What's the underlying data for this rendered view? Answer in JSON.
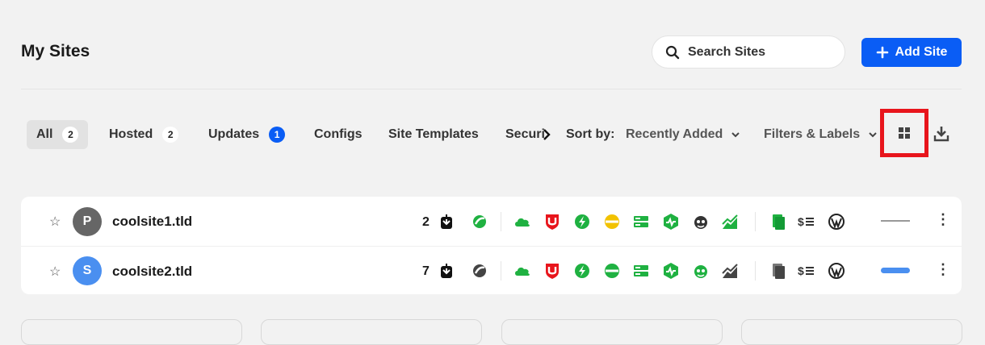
{
  "header": {
    "title": "My Sites",
    "search_placeholder": "Search Sites",
    "add_site_label": "Add Site"
  },
  "tabs": [
    {
      "label": "All",
      "count": "2"
    },
    {
      "label": "Hosted",
      "count": "2"
    },
    {
      "label": "Updates",
      "count": "1"
    },
    {
      "label": "Configs"
    },
    {
      "label": "Site Templates"
    },
    {
      "label": "Securi"
    }
  ],
  "sort": {
    "label": "Sort by:",
    "value": "Recently Added"
  },
  "filters_label": "Filters & Labels",
  "sites": [
    {
      "initial": "P",
      "name": "coolsite1.tld",
      "updates": "2",
      "avatar_color": "#666666",
      "performance": "line"
    },
    {
      "initial": "S",
      "name": "coolsite2.tld",
      "updates": "7",
      "avatar_color": "#4a8ff0",
      "performance": "bar"
    }
  ],
  "colors": {
    "accent": "#0a5df5",
    "success": "#1fb141",
    "warning": "#f2c200",
    "danger": "#e8151c"
  },
  "icons": [
    "search-icon",
    "plus-icon",
    "chevron-right-icon",
    "chevron-down-icon",
    "grid-view-icon",
    "download-icon",
    "star-icon",
    "update-icon",
    "hosting-icon",
    "cloud-icon",
    "shield-icon",
    "bolt-icon",
    "menu-icon",
    "server-icon",
    "uptime-icon",
    "seo-icon",
    "analytics-icon",
    "reports-icon",
    "billing-icon",
    "wordpress-icon",
    "kebab-icon"
  ]
}
